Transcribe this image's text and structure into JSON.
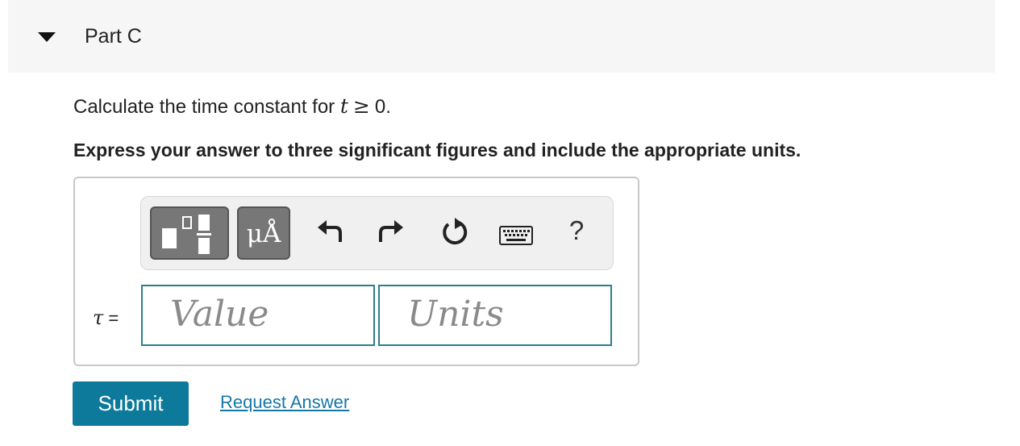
{
  "part": {
    "title": "Part C",
    "toggle_icon": "caret-down-icon"
  },
  "question": {
    "prefix": "Calculate the time constant for ",
    "variable": "t",
    "operator": "≥",
    "value": "0."
  },
  "instruction": "Express your answer to three significant figures and include the appropriate units.",
  "answer": {
    "symbol": "τ",
    "equals": "=",
    "value_placeholder": "Value",
    "units_placeholder": "Units",
    "field_border_color": "#2f7f8a"
  },
  "toolbar": {
    "templates_icon": "templates-icon",
    "units_label": "μÅ",
    "undo_icon": "undo-icon",
    "redo_icon": "redo-icon",
    "reset_icon": "reset-icon",
    "keyboard_icon": "keyboard-icon",
    "help_label": "?"
  },
  "actions": {
    "submit_label": "Submit",
    "request_answer_label": "Request Answer",
    "submit_color": "#0d7a9c",
    "link_color": "#1677a8"
  }
}
